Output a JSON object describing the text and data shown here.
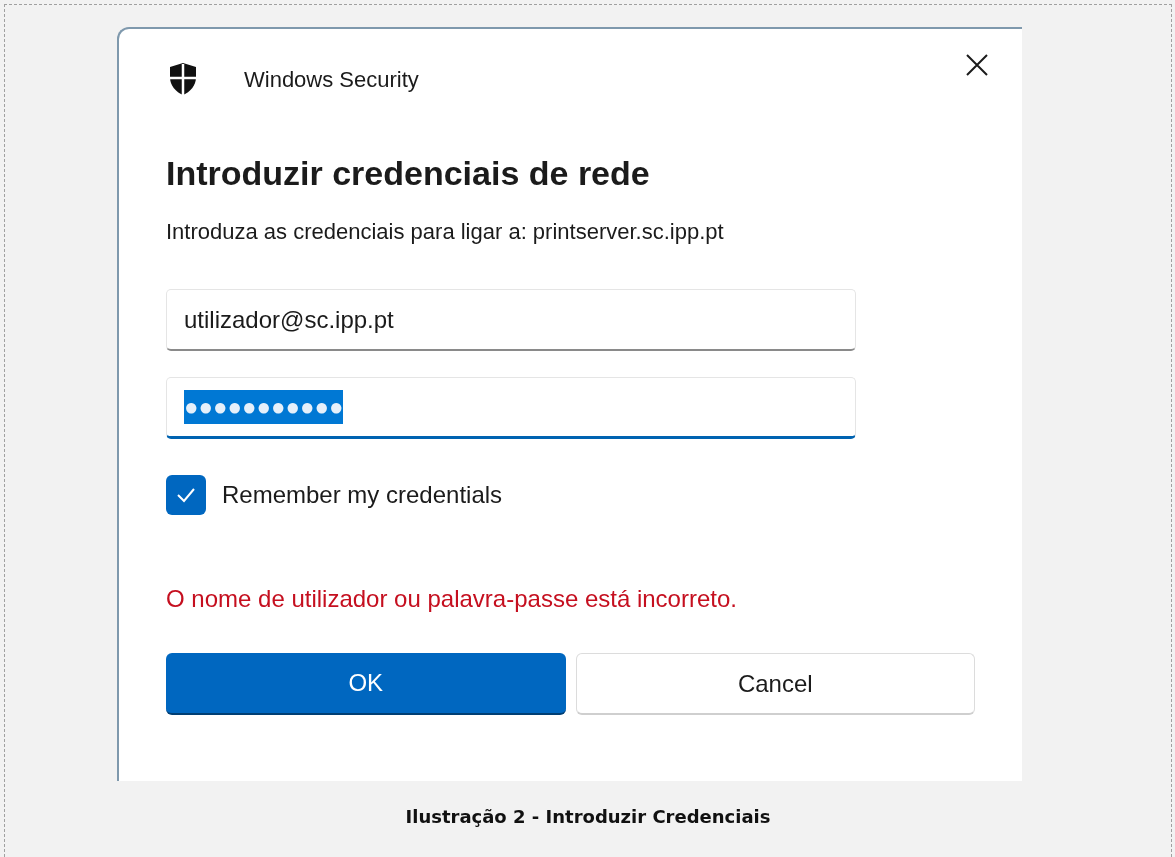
{
  "dialog": {
    "app_title": "Windows Security",
    "heading": "Introduzir credenciais de rede",
    "message": "Introduza as credenciais para ligar a: printserver.sc.ipp.pt",
    "username": {
      "value": "utilizador@sc.ipp.pt",
      "focused": false
    },
    "password": {
      "value": "●●●●●●●●●●●",
      "focused": true,
      "selected": true
    },
    "remember": {
      "label": "Remember my credentials",
      "checked": true
    },
    "error": "O nome de utilizador ou palavra-passe está incorreto.",
    "buttons": [
      {
        "label": "OK",
        "kind": "primary"
      },
      {
        "label": "Cancel",
        "kind": "secondary"
      }
    ]
  },
  "caption": "Ilustração 2 - Introduzir Credenciais"
}
